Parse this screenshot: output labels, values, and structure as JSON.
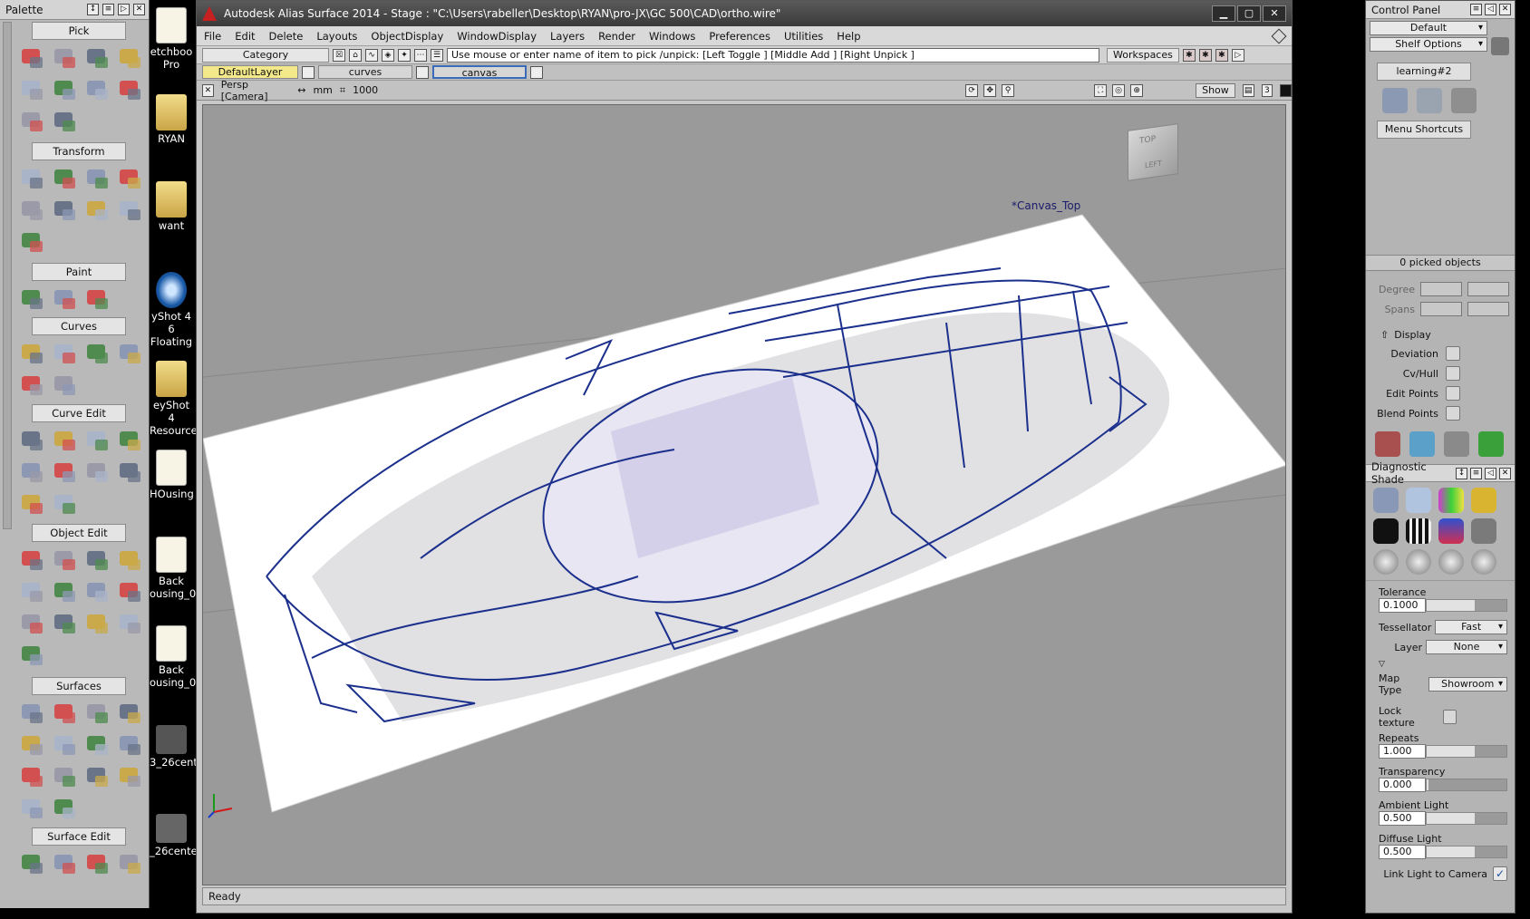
{
  "palette": {
    "title": "Palette",
    "sections": [
      {
        "label": "Pick"
      },
      {
        "label": "Transform"
      },
      {
        "label": "Paint"
      },
      {
        "label": "Curves"
      },
      {
        "label": "Curve Edit"
      },
      {
        "label": "Object Edit"
      },
      {
        "label": "Surfaces"
      },
      {
        "label": "Surface Edit"
      }
    ]
  },
  "desktop": {
    "icons": [
      {
        "label": "etchboo Pro"
      },
      {
        "label": "RYAN"
      },
      {
        "label": "want"
      },
      {
        "label": "yShot 4 6 Floating"
      },
      {
        "label": "eyShot 4 Resources"
      },
      {
        "label": "HOusing"
      },
      {
        "label": "Back ousing_0."
      },
      {
        "label": "Back ousing_0."
      },
      {
        "label": "3_26cent."
      },
      {
        "label": "_26cente"
      }
    ]
  },
  "window": {
    "title": "Autodesk Alias Surface 2014      - Stage : \"C:\\Users\\rabeller\\Desktop\\RYAN\\pro-JX\\GC 500\\CAD\\ortho.wire\"",
    "menus": [
      "File",
      "Edit",
      "Delete",
      "Layouts",
      "ObjectDisplay",
      "WindowDisplay",
      "Layers",
      "Render",
      "Windows",
      "Preferences",
      "Utilities",
      "Help"
    ],
    "pick": {
      "category": "Category",
      "prompt": "Use mouse or enter name of item to pick /unpick: [Left Toggle ] [Middle Add ] [Right Unpick ]",
      "workspaces": "Workspaces"
    },
    "layers": [
      {
        "name": "DefaultLayer",
        "color": "#f3e98a"
      },
      {
        "name": "curves",
        "color": "#d6d6d6"
      },
      {
        "name": "canvas",
        "color": "#d6d6d6"
      }
    ],
    "view": {
      "camera": "Persp [Camera]",
      "units": "mm",
      "scale": "1000",
      "show": "Show",
      "num": "3"
    },
    "viewcube": {
      "top": "TOP",
      "left": "LEFT"
    },
    "canvas_label": "*Canvas_Top",
    "status": "Ready"
  },
  "control_panel": {
    "title": "Control Panel",
    "default": "Default",
    "shelf_options": "Shelf Options",
    "shelf_tab": "learning#2",
    "menu_shortcuts": "Menu Shortcuts",
    "picked": "0 picked objects",
    "degree_label": "Degree",
    "spans_label": "Spans",
    "display_label": "Display",
    "display_items": [
      {
        "label": "Deviation"
      },
      {
        "label": "Cv/Hull"
      },
      {
        "label": "Edit Points"
      },
      {
        "label": "Blend Points"
      }
    ],
    "diag_title": "Diagnostic Shade",
    "tolerance_label": "Tolerance",
    "tolerance": "0.1000",
    "tessellator_label": "Tessellator",
    "tessellator": "Fast",
    "layer_label": "Layer",
    "layer": "None",
    "maptype_label": "Map Type",
    "maptype": "Showroom",
    "lock_texture": "Lock texture",
    "repeats_label": "Repeats",
    "repeats": "1.000",
    "transparency_label": "Transparency",
    "transparency": "0.000",
    "ambient_label": "Ambient Light",
    "ambient": "0.500",
    "diffuse_label": "Diffuse Light",
    "diffuse": "0.500",
    "link_light": "Link Light to Camera"
  }
}
